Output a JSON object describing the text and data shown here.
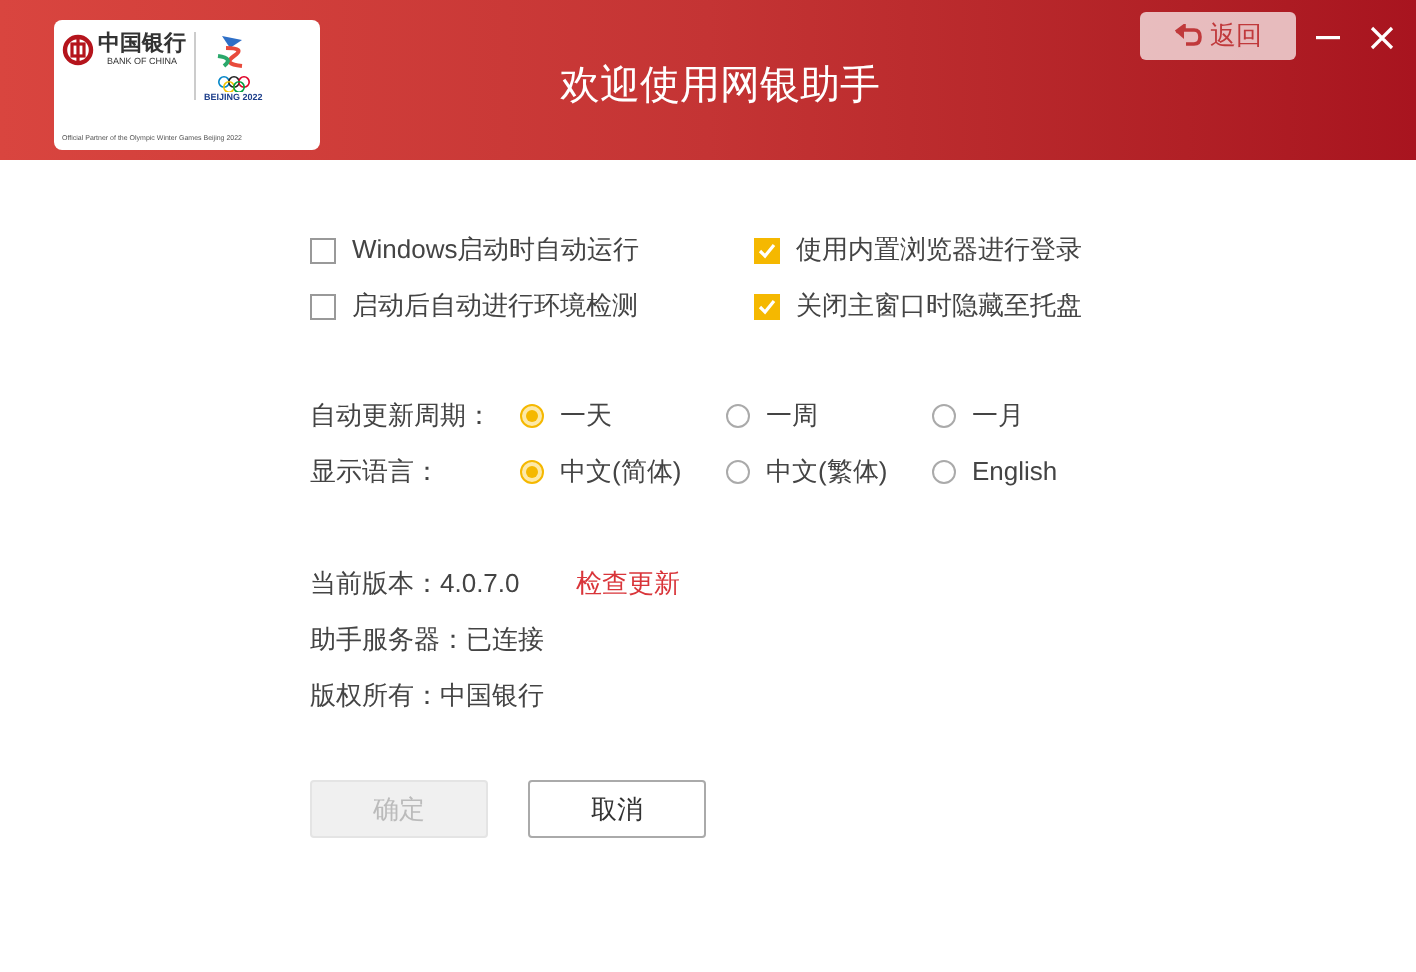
{
  "header": {
    "logo": {
      "bank_name": "中国银行",
      "bank_name_en": "BANK OF CHINA",
      "games": "BEIJING 2022",
      "partner_en": "Official Partner of the Olympic Winter Games Beijing 2022"
    },
    "title": "欢迎使用网银助手",
    "back_button": "返回"
  },
  "options": [
    {
      "label": "Windows启动时自动运行",
      "checked": false
    },
    {
      "label": "使用内置浏览器进行登录",
      "checked": true
    },
    {
      "label": "启动后自动进行环境检测",
      "checked": false
    },
    {
      "label": "关闭主窗口时隐藏至托盘",
      "checked": true
    }
  ],
  "radio_groups": [
    {
      "label": "自动更新周期：",
      "options": [
        {
          "label": "一天",
          "selected": true
        },
        {
          "label": "一周",
          "selected": false
        },
        {
          "label": "一月",
          "selected": false
        }
      ]
    },
    {
      "label": "显示语言：",
      "options": [
        {
          "label": "中文(简体)",
          "selected": true
        },
        {
          "label": "中文(繁体)",
          "selected": false
        },
        {
          "label": "English",
          "selected": false
        }
      ]
    }
  ],
  "info": [
    {
      "label": "当前版本：",
      "value": "4.0.7.0",
      "link": "检查更新"
    },
    {
      "label": "助手服务器：",
      "value": "已连接"
    },
    {
      "label": "版权所有：",
      "value": "中国银行"
    }
  ],
  "buttons": [
    {
      "label": "确定",
      "disabled": true
    },
    {
      "label": "取消",
      "disabled": false
    }
  ]
}
